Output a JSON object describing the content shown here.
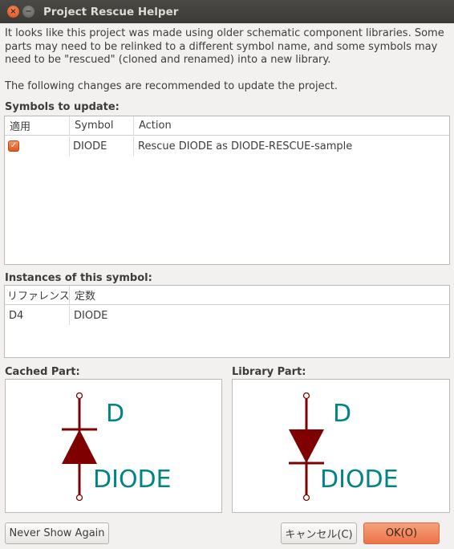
{
  "window": {
    "title": "Project Rescue Helper"
  },
  "intro": {
    "paragraph1": "It looks like this project was made using older schematic component libraries. Some parts may need to be relinked to a different symbol name, and some symbols may need to be \"rescued\" (cloned and renamed) into a new library.",
    "paragraph2": "The following changes are recommended to update the project."
  },
  "symbols": {
    "label": "Symbols to update:",
    "columns": [
      "適用",
      "Symbol",
      "Action"
    ],
    "rows": [
      {
        "apply": true,
        "symbol": "DIODE",
        "action": "Rescue DIODE as DIODE-RESCUE-sample"
      }
    ]
  },
  "instances": {
    "label": "Instances of this symbol:",
    "columns": [
      "リファレンス",
      "定数"
    ],
    "rows": [
      {
        "reference": "D4",
        "value": "DIODE"
      }
    ]
  },
  "cached_part": {
    "label": "Cached Part:",
    "ref_text": "D",
    "value_text": "DIODE",
    "orientation": "up"
  },
  "library_part": {
    "label": "Library Part:",
    "ref_text": "D",
    "value_text": "DIODE",
    "orientation": "down"
  },
  "buttons": {
    "never_show": "Never Show Again",
    "cancel": "キャンセル(C)",
    "ok": "OK(O)"
  },
  "colors": {
    "symbol_body": "#7f0000",
    "symbol_text": "#008484",
    "accent": "#ec7347"
  }
}
